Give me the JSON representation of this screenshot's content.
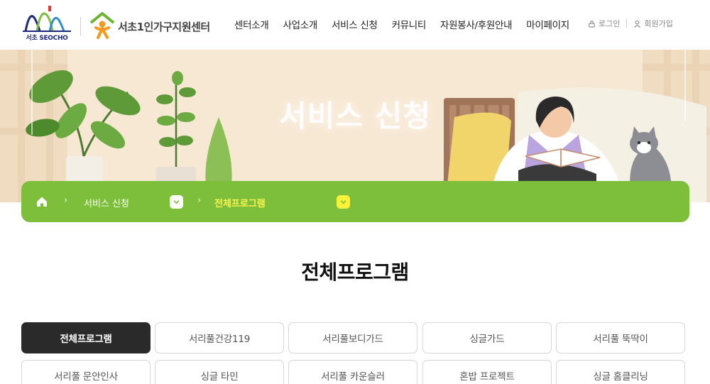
{
  "header": {
    "seocho_logo_text": "서초 SEOCHO",
    "center_name": "서초1인가구지원센터",
    "nav": [
      "센터소개",
      "사업소개",
      "서비스 신청",
      "커뮤니티",
      "자원봉사/후원안내",
      "마이페이지"
    ],
    "login": "로그인",
    "signup": "회원가입"
  },
  "hero": {
    "title": "서비스 신청"
  },
  "breadcrumb": {
    "arrow": "›",
    "level1": "서비스 신청",
    "level2": "전체프로그램"
  },
  "page_title": "전체프로그램",
  "tabs": [
    {
      "label": "전체프로그램",
      "active": true
    },
    {
      "label": "서리풀건강119",
      "active": false
    },
    {
      "label": "서리풀보디가드",
      "active": false
    },
    {
      "label": "싱글가드",
      "active": false
    },
    {
      "label": "서리풀 뚝딱이",
      "active": false
    },
    {
      "label": "서리풀 문안인사",
      "active": false
    },
    {
      "label": "싱글 타민",
      "active": false
    },
    {
      "label": "서리풀 카운슬러",
      "active": false
    },
    {
      "label": "혼밥 프로젝트",
      "active": false
    },
    {
      "label": "싱글 홈클리닝",
      "active": false
    }
  ],
  "colors": {
    "accent_green": "#7dbf3a",
    "crumb_current": "#fff34d",
    "active_tab": "#2a2a2a",
    "hero_bg": "#f7e8d4"
  }
}
